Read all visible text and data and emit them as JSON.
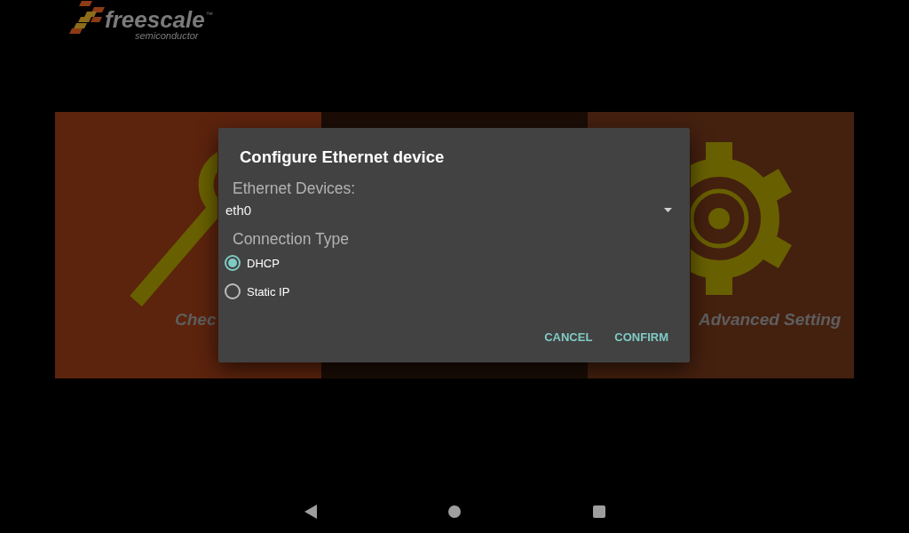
{
  "logo": {
    "wordmark": "freescale",
    "trademark": "™",
    "tagline": "semiconductor"
  },
  "tiles": [
    {
      "kind": "magnifier",
      "label": "Chec",
      "color": "#5c230d"
    },
    {
      "kind": "plain",
      "color": "#1b0d06"
    },
    {
      "kind": "gear",
      "label": "Advanced Setting",
      "color": "#44200f"
    }
  ],
  "dialog": {
    "title": "Configure Ethernet device",
    "device_label": "Ethernet Devices:",
    "device_value": "eth0",
    "connection_label": "Connection Type",
    "connection_types": [
      {
        "label": "DHCP",
        "selected": true
      },
      {
        "label": "Static IP",
        "selected": false
      }
    ],
    "buttons": [
      "CANCEL",
      "CONFIRM"
    ]
  }
}
